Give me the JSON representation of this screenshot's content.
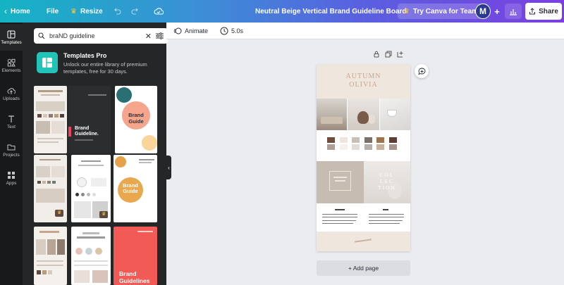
{
  "topbar": {
    "home_label": "Home",
    "file_label": "File",
    "resize_label": "Resize",
    "doc_title": "Neutral Beige Vertical Brand Guideline Board",
    "try_label": "Try Canva for Teams",
    "avatar_initial": "M",
    "share_label": "Share"
  },
  "rail": {
    "items": [
      {
        "label": "Templates"
      },
      {
        "label": "Elements"
      },
      {
        "label": "Uploads"
      },
      {
        "label": "Text"
      },
      {
        "label": "Projects"
      },
      {
        "label": "Apps"
      }
    ]
  },
  "panel": {
    "search_value": "braND guideline",
    "promo_title": "Templates Pro",
    "promo_desc": "Unlock our entire library of premium templates, free for 30 days."
  },
  "thumbs": {
    "t2_title": "Brand Guideline.",
    "t3_title": "Brand Guide",
    "t6_title": "Brand Guide",
    "t9_title": "Brand Guidelines"
  },
  "toolbar": {
    "animate_label": "Animate",
    "duration_label": "5.0s"
  },
  "page": {
    "title_line1": "AUTUMN",
    "title_line2": "OLIVIA",
    "collection_line1": "COL",
    "collection_line2": "LEC",
    "collection_line3": "TION",
    "palette": [
      "#6d4e3e",
      "#efe5dc",
      "#c8c0b8",
      "#7a7068",
      "#a0734e",
      "#5e3c33"
    ]
  },
  "add_page_label": "+ Add page"
}
